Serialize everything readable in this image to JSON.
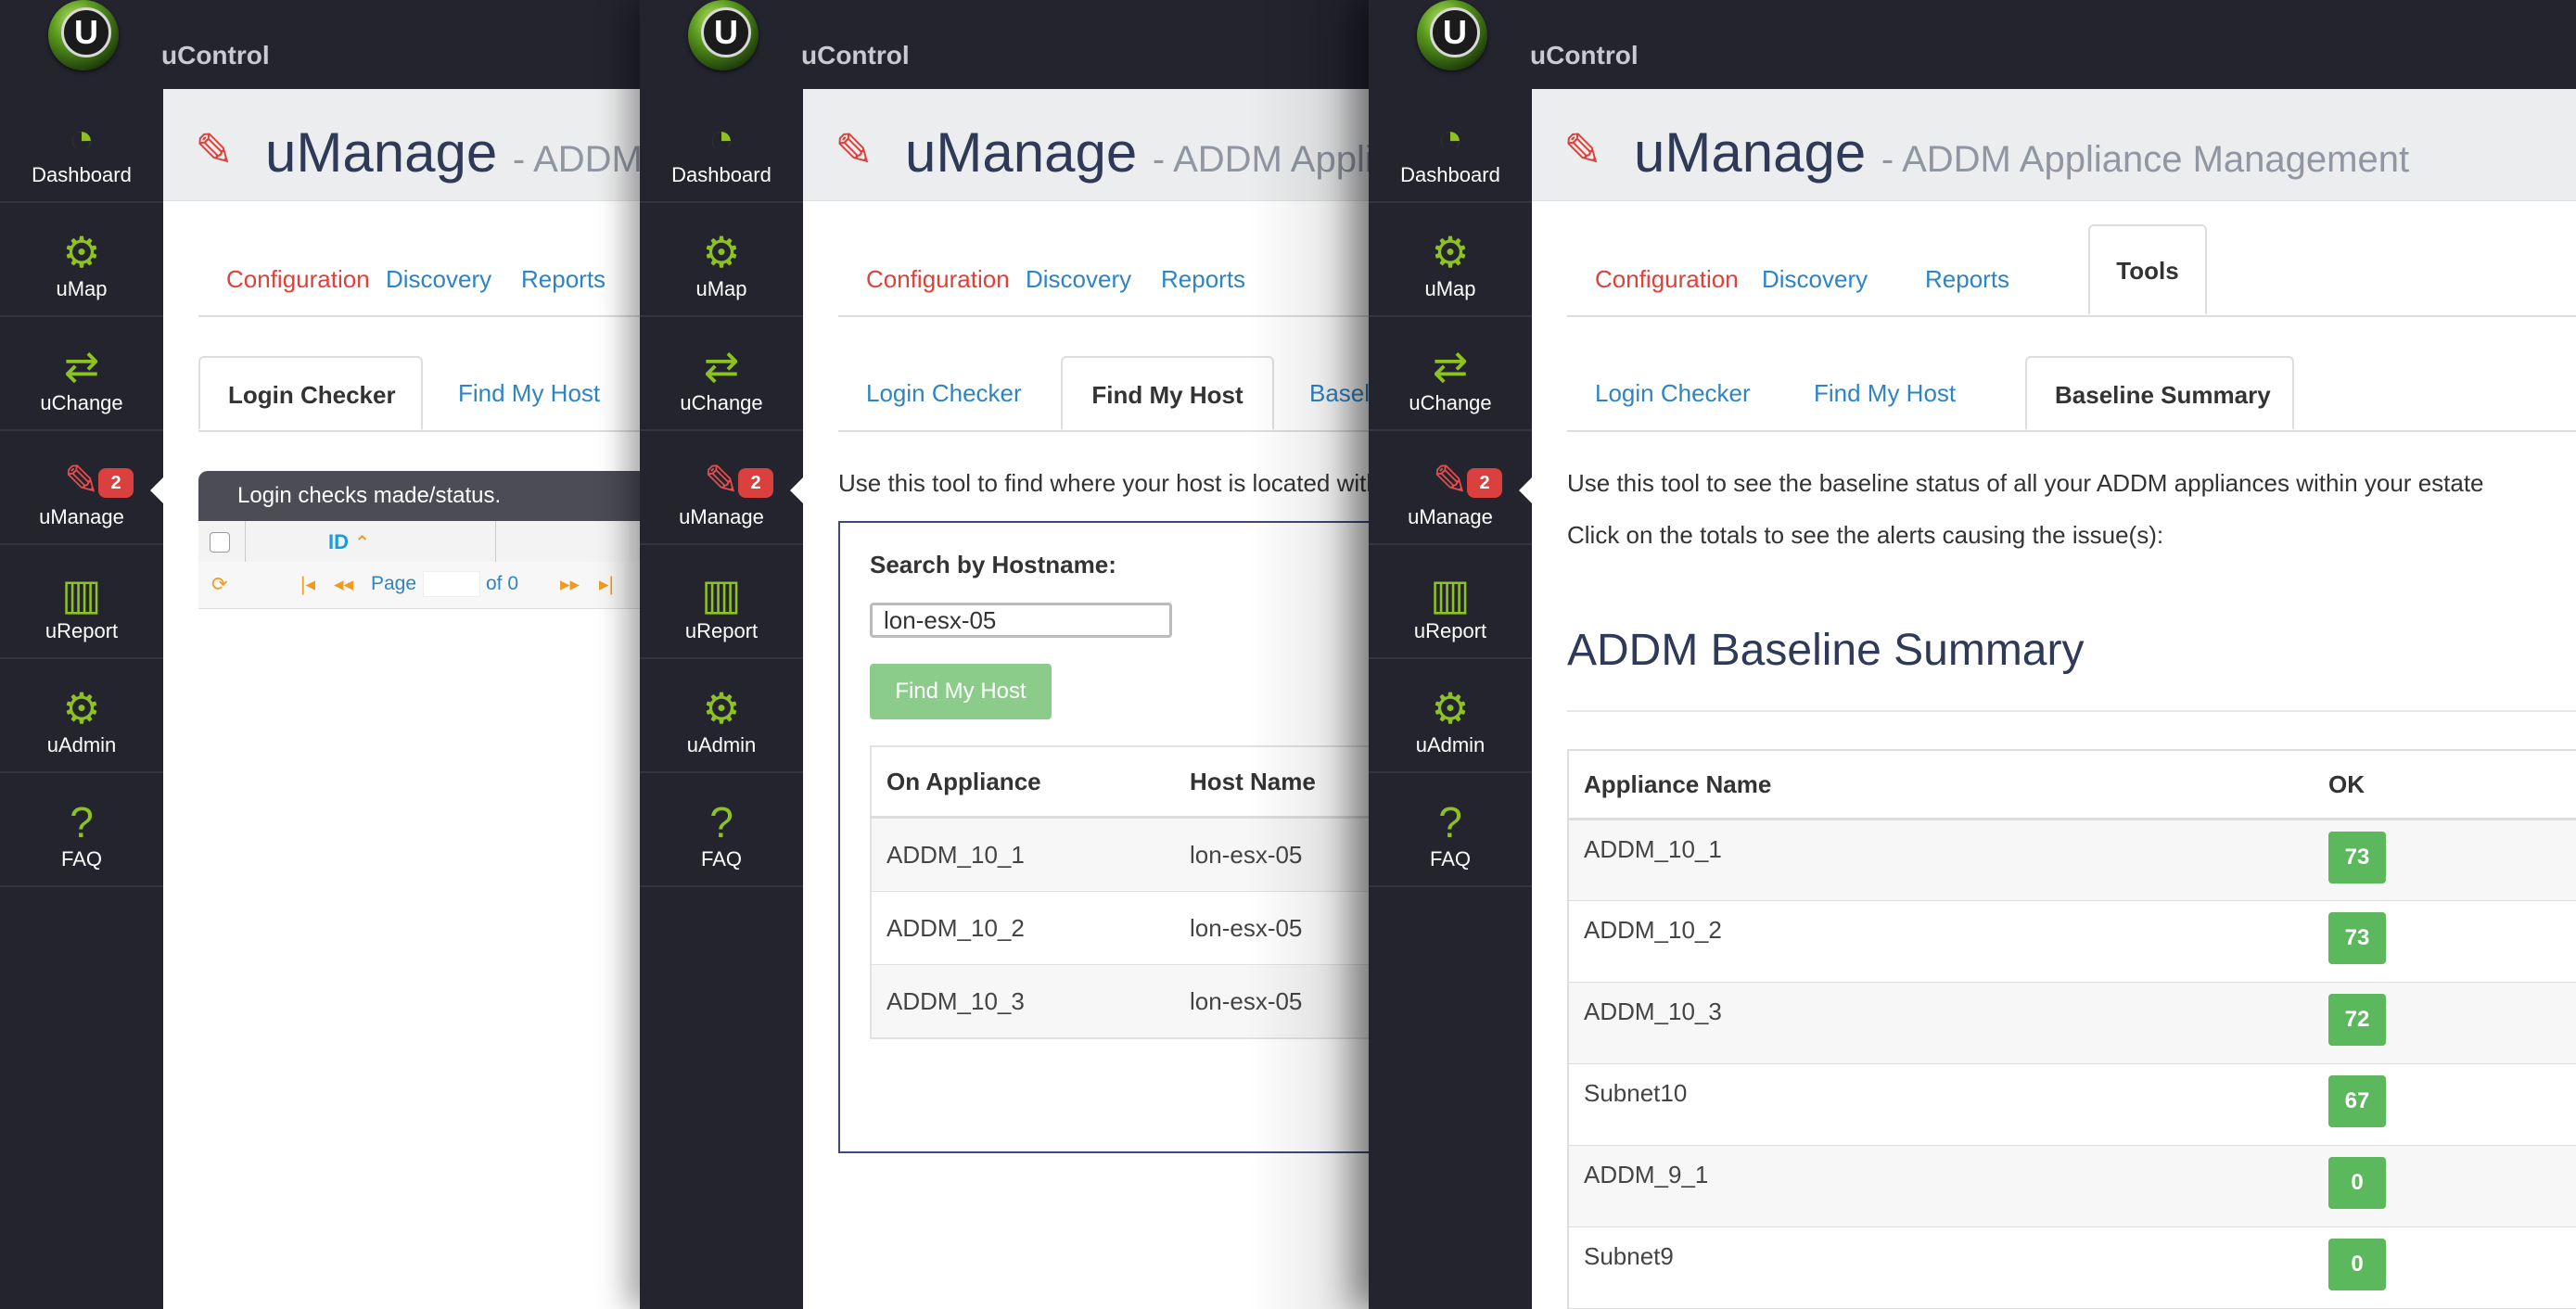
{
  "app": {
    "name": "uControl",
    "logo_letter": "U"
  },
  "nav": {
    "items": [
      {
        "label": "Dashboard",
        "icon": "dashboard-icon",
        "glyph": "◔"
      },
      {
        "label": "uMap",
        "icon": "gear-icon",
        "glyph": "⚙"
      },
      {
        "label": "uChange",
        "icon": "retweet-icon",
        "glyph": "⇄"
      },
      {
        "label": "uManage",
        "icon": "wrench-icon",
        "glyph": "✎",
        "badge": "2"
      },
      {
        "label": "uReport",
        "icon": "bar-chart-icon",
        "glyph": "▥"
      },
      {
        "label": "uAdmin",
        "icon": "gears-icon",
        "glyph": "⚙"
      },
      {
        "label": "FAQ",
        "icon": "question-icon",
        "glyph": "?"
      }
    ]
  },
  "header": {
    "title": "uManage",
    "subtitle": "- ADDM Appliance Management",
    "wrench_glyph": "✎"
  },
  "tabs": {
    "main": [
      "Configuration",
      "Discovery",
      "Reports",
      "Tools"
    ],
    "sub": [
      "Login Checker",
      "Find My Host",
      "Baseline Summary"
    ]
  },
  "login_checker": {
    "grid_title": "Login checks made/status.",
    "col_id": "ID",
    "sort_glyph": "⌃",
    "pager": {
      "first": "|◂",
      "prev": "◂◂",
      "page_label": "Page",
      "of_label": "of 0",
      "next": "▸▸",
      "last": "▸|",
      "refresh": "⟳"
    }
  },
  "find_host": {
    "description": "Use this tool to find where your host is located within your estate",
    "search_label": "Search by Hostname:",
    "search_value": "lon-esx-05",
    "button_label": "Find My Host",
    "columns": [
      "On Appliance",
      "Host Name"
    ],
    "rows": [
      {
        "appliance": "ADDM_10_1",
        "host": "lon-esx-05"
      },
      {
        "appliance": "ADDM_10_2",
        "host": "lon-esx-05"
      },
      {
        "appliance": "ADDM_10_3",
        "host": "lon-esx-05"
      }
    ]
  },
  "baseline": {
    "desc1": "Use this tool to see the baseline status of all your ADDM appliances within your estate",
    "desc2": "Click on the totals to see the alerts causing the issue(s):",
    "title": "ADDM Baseline Summary",
    "columns": [
      "Appliance Name",
      "OK"
    ],
    "rows": [
      {
        "name": "ADDM_10_1",
        "ok": "73"
      },
      {
        "name": "ADDM_10_2",
        "ok": "73"
      },
      {
        "name": "ADDM_10_3",
        "ok": "72"
      },
      {
        "name": "Subnet10",
        "ok": "67"
      },
      {
        "name": "ADDM_9_1",
        "ok": "0"
      },
      {
        "name": "Subnet9",
        "ok": "0"
      }
    ]
  },
  "colors": {
    "sidebar_bg": "#23242e",
    "accent_green": "#8dc21f",
    "accent_red": "#e24c4b",
    "link_blue": "#2e84c4",
    "ok_green": "#5cb85c",
    "title_navy": "#2e3a57"
  }
}
